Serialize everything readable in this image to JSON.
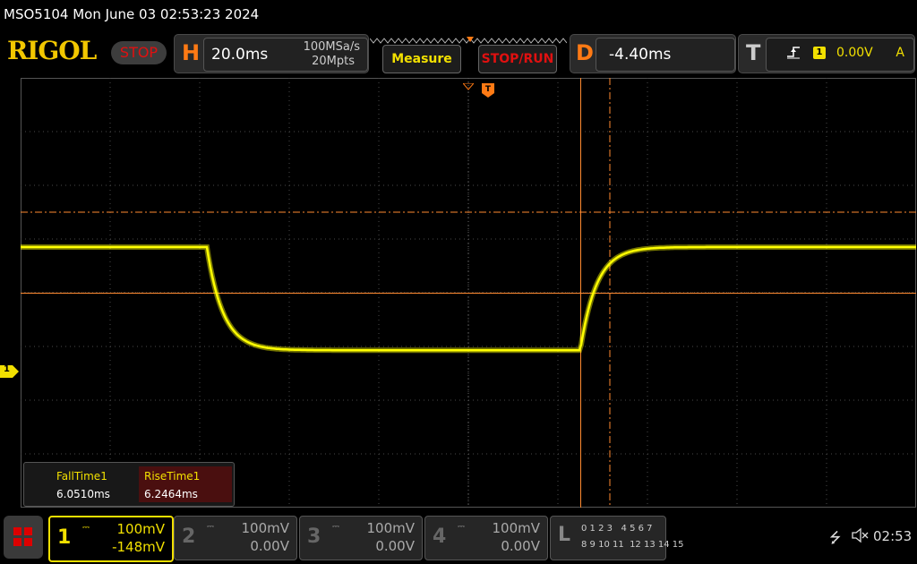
{
  "title_bar": {
    "text": "MSO5104  Mon June 03 02:53:23 2024"
  },
  "top_bar": {
    "logo": "RIGOL",
    "run_state": "STOP",
    "horizontal": {
      "letter": "H",
      "timebase": "20.0ms",
      "sample_rate": "100MSa/s",
      "memory_depth": "20Mpts"
    },
    "measure_button": "Measure",
    "stop_run_button": "STOP/RUN",
    "delay": {
      "letter": "D",
      "value": "-4.40ms"
    },
    "trigger": {
      "letter": "T",
      "channel": "1",
      "level": "0.00V",
      "mode": "A"
    }
  },
  "waveform": {
    "channel": "1",
    "channel_marker": "1",
    "color": "#ffff00",
    "high_level_div": 4.85,
    "low_level_div": 2.93,
    "fall_start_div": 2.08,
    "rise_start_div": 6.25
  },
  "measurements": [
    {
      "name": "FallTime1",
      "value": "6.0510ms"
    },
    {
      "name": "RiseTime1",
      "value": "6.2464ms"
    }
  ],
  "bottom_bar": {
    "channels": [
      {
        "num": "1",
        "scale": "100mV",
        "offset": "-148mV",
        "active": true
      },
      {
        "num": "2",
        "scale": "100mV",
        "offset": "0.00V",
        "active": false
      },
      {
        "num": "3",
        "scale": "100mV",
        "offset": "0.00V",
        "active": false
      },
      {
        "num": "4",
        "scale": "100mV",
        "offset": "0.00V",
        "active": false
      }
    ],
    "logic": {
      "letter": "L",
      "row1": "0 1 2 3   4 5 6 7",
      "row2": "8 9 10 11  12 13 14 15"
    },
    "time": "02:53"
  },
  "colors": {
    "trace": "#ffff00",
    "cursor": "#ff8a30",
    "brand": "#f2c700",
    "stop": "#e01010"
  }
}
